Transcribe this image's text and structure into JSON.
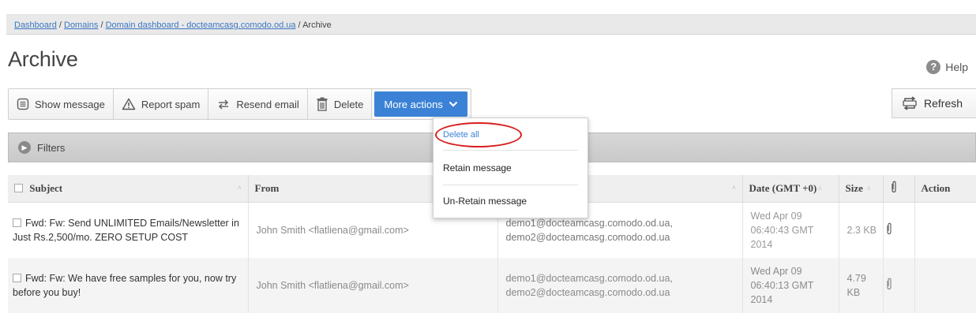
{
  "breadcrumb": {
    "items": [
      "Dashboard",
      "Domains",
      "Domain dashboard - docteamcasg.comodo.od.ua"
    ],
    "separator": " / ",
    "current": "Archive"
  },
  "page": {
    "title": "Archive",
    "help_label": "Help"
  },
  "toolbar": {
    "show_message": "Show message",
    "report_spam": "Report spam",
    "resend_email": "Resend email",
    "delete": "Delete",
    "more_actions": "More actions",
    "refresh": "Refresh"
  },
  "dropdown": {
    "items": [
      "Delete all",
      "Retain message",
      "Un-Retain message"
    ]
  },
  "filters": {
    "label": "Filters"
  },
  "table": {
    "columns": [
      "Subject",
      "From",
      "",
      "Date (GMT +0)",
      "Size",
      "",
      "Action"
    ],
    "rows": [
      {
        "subject": "Fwd: Fw: Send UNLIMITED Emails/Newsletter in Just Rs.2,500/mo. ZERO SETUP COST",
        "from": "John Smith <flatliena@gmail.com>",
        "to": "demo1@docteamcasg.comodo.od.ua, demo2@docteamcasg.comodo.od.ua",
        "date": "Wed Apr 09 06:40:43 GMT 2014",
        "size": "2.3 KB"
      },
      {
        "subject": "Fwd: Fw: We have free samples for you, now try before you buy!",
        "from": "John Smith <flatliena@gmail.com>",
        "to": "demo1@docteamcasg.comodo.od.ua, demo2@docteamcasg.comodo.od.ua",
        "date": "Wed Apr 09 06:40:13 GMT 2014",
        "size": "4.79 KB"
      }
    ]
  },
  "colors": {
    "accent": "#3b82d6",
    "highlight": "#d81e1e"
  }
}
